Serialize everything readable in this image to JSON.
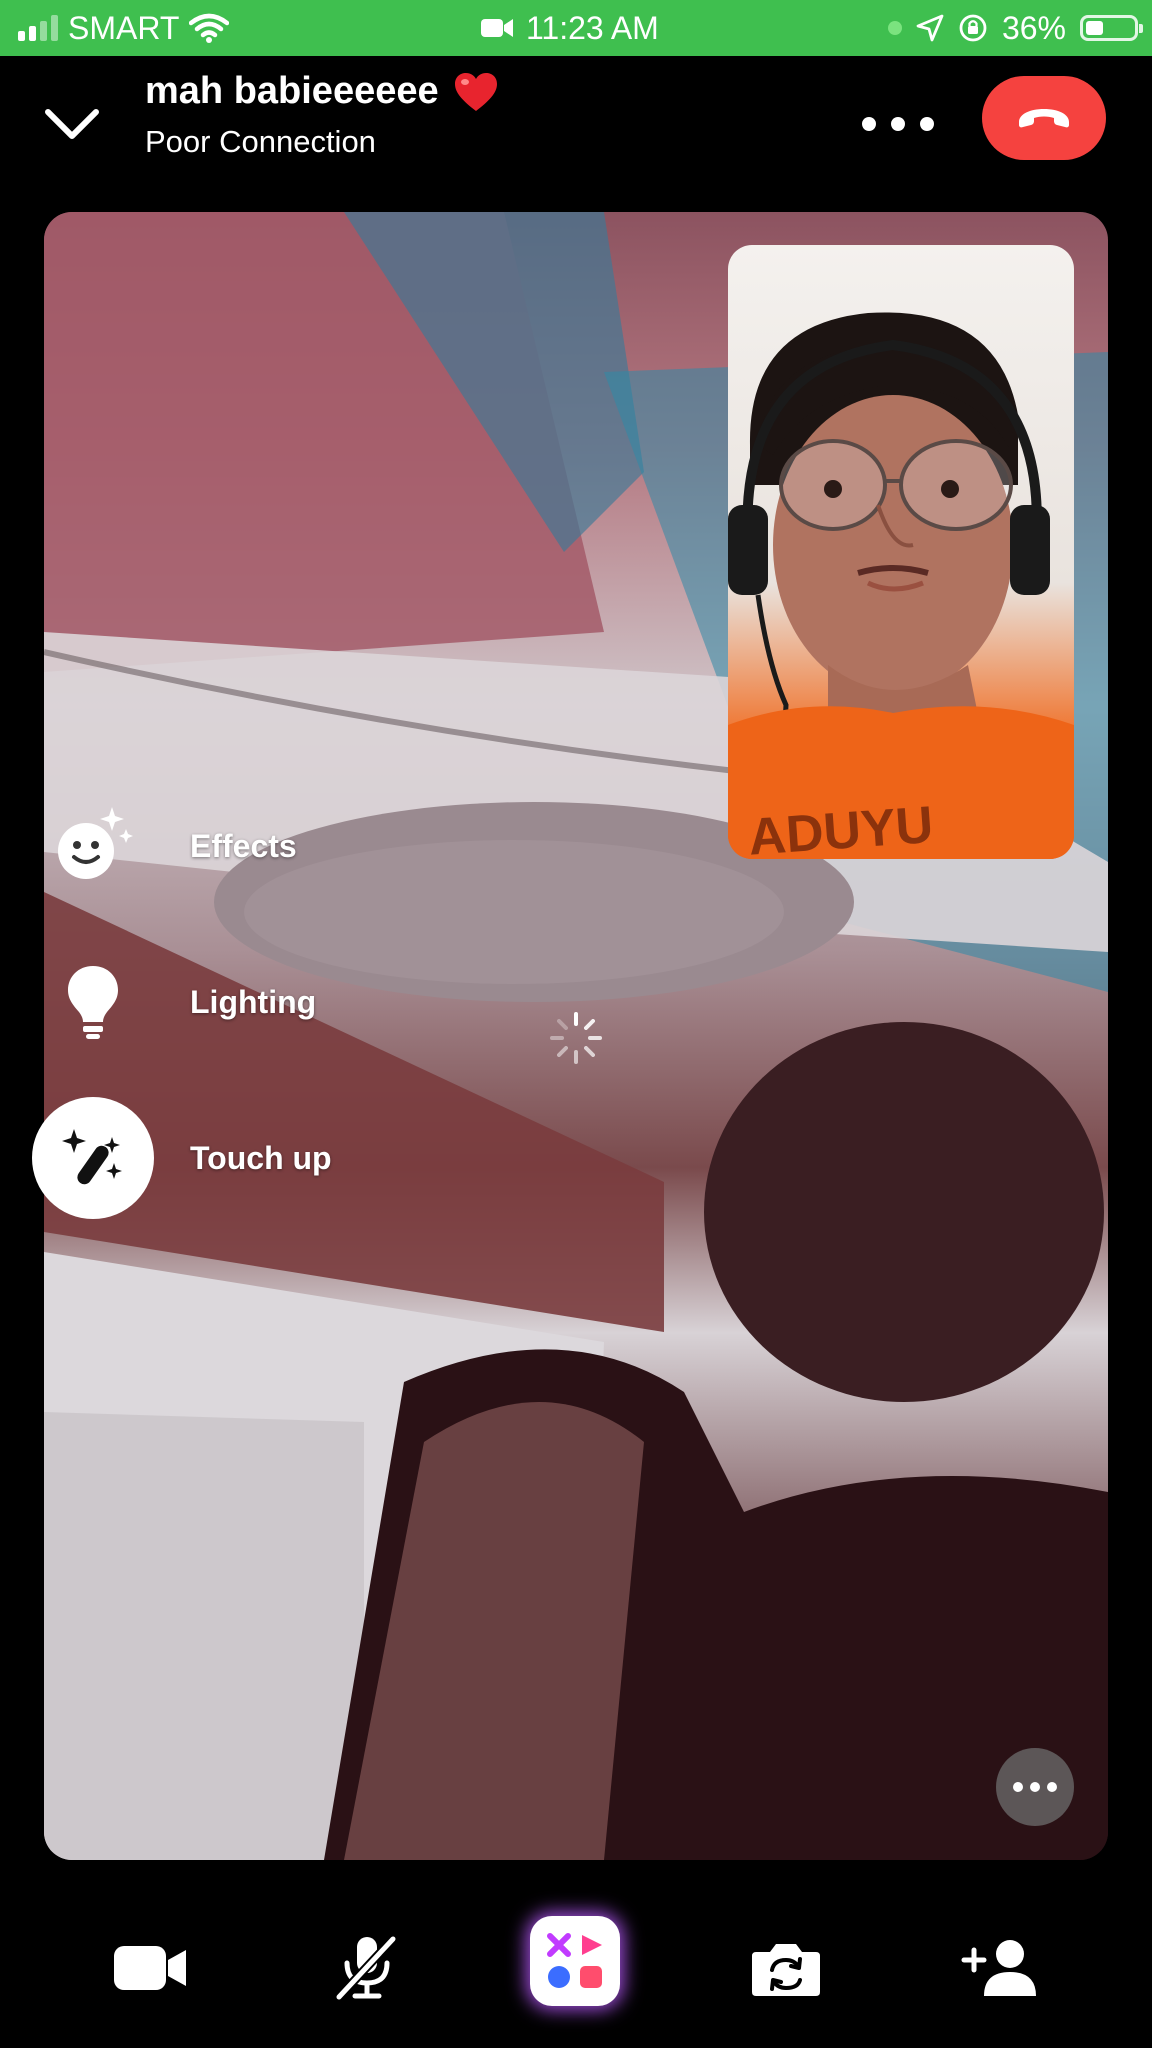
{
  "status_bar": {
    "carrier": "SMART",
    "time": "11:23 AM",
    "battery_percent": "36%",
    "battery_level": 0.36,
    "signal_bars_active": 2,
    "icons": [
      "signal-icon",
      "wifi-icon",
      "video-recording-icon",
      "location-arrow-icon",
      "orientation-lock-icon",
      "battery-icon"
    ]
  },
  "header": {
    "contact_name": "mah babieeeeee",
    "contact_emoji": "❤️",
    "connection_status": "Poor Connection",
    "icons": [
      "chevron-down-icon",
      "more-icon",
      "end-call-icon"
    ],
    "end_call_color": "#f5423f"
  },
  "tools": [
    {
      "label": "Effects",
      "icon": "smiley-sparkle-icon",
      "active": false
    },
    {
      "label": "Lighting",
      "icon": "lightbulb-icon",
      "active": false
    },
    {
      "label": "Touch up",
      "icon": "magic-wand-icon",
      "active": true
    }
  ],
  "pip_text": "ADUYU",
  "bottom_bar": {
    "icons": [
      "camera-icon",
      "microphone-muted-icon",
      "effects-icon",
      "flip-camera-icon",
      "add-person-icon"
    ],
    "effects_colors": [
      "#c13bff",
      "#ff3e8f",
      "#3b6dff",
      "#ff4d6d"
    ]
  }
}
